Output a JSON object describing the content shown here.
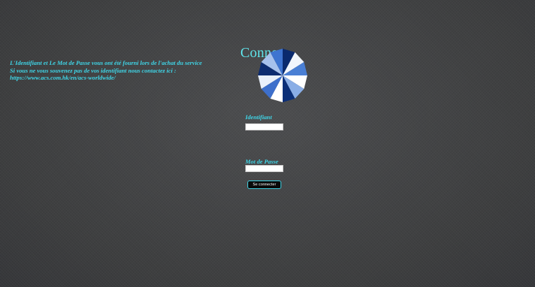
{
  "info": {
    "line1": "L'Identifiant et Le Mot de Passe vous ont été fourni lors de l'achat du service",
    "line2": "Si vous ne vous souvenez pas de vos identifiant nous contactez ici :",
    "line3": "https://www.acs.com.hk/en/acs-worldwide/"
  },
  "login": {
    "title": "Connex",
    "username_label": "Identifiant",
    "username_value": "",
    "password_label": "Mot de Passe",
    "password_value": "",
    "submit_label": "Se connecter"
  },
  "spinner": {
    "icon": "loading-spinner-icon",
    "segment_colors": [
      "#0a2a6e",
      "#f2f6fc",
      "#4a7fd4",
      "#ffffff",
      "#8aaee6",
      "#0c2f78",
      "#ffffff",
      "#3d6fcb",
      "#e9f0fb",
      "#0d2c70",
      "#a7c1ec",
      "#3e74d0"
    ]
  }
}
